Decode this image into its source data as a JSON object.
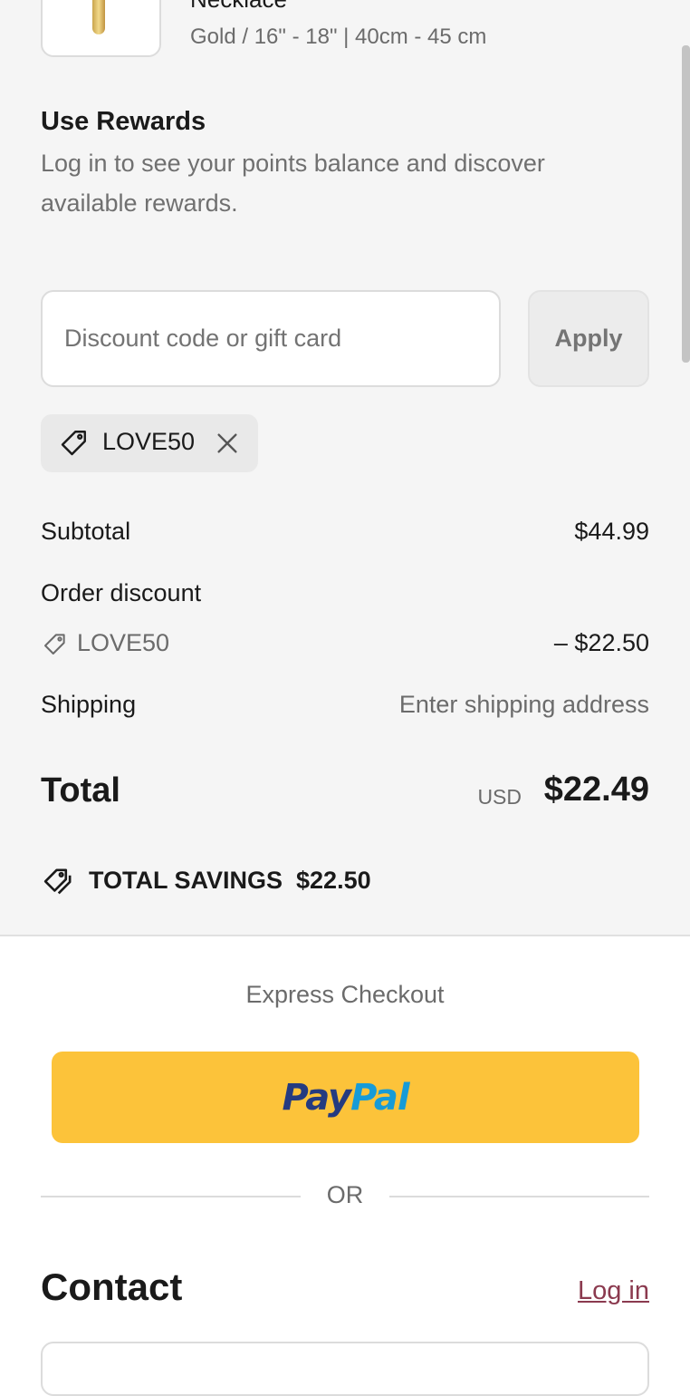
{
  "item": {
    "title": "Necklace",
    "variant": "Gold / 16\" - 18\" | 40cm - 45 cm"
  },
  "rewards": {
    "title": "Use Rewards",
    "text": "Log in to see your points balance and discover available rewards."
  },
  "discount": {
    "placeholder": "Discount code or gift card",
    "apply_label": "Apply",
    "applied_code": "LOVE50"
  },
  "summary": {
    "subtotal_label": "Subtotal",
    "subtotal_value": "$44.99",
    "order_discount_label": "Order discount",
    "discount_code": "LOVE50",
    "discount_value": "– $22.50",
    "shipping_label": "Shipping",
    "shipping_value": "Enter shipping address",
    "total_label": "Total",
    "currency": "USD",
    "total_value": "$22.49",
    "savings_label": "TOTAL SAVINGS  $22.50"
  },
  "express": {
    "title": "Express Checkout",
    "paypal_pay": "Pay",
    "paypal_pal": "Pal",
    "or_label": "OR"
  },
  "contact": {
    "title": "Contact",
    "login_label": "Log in"
  },
  "colors": {
    "summary_bg": "#f5f5f5",
    "paypal_yellow": "#fcc33a",
    "paypal_dark_blue": "#253b80",
    "paypal_light_blue": "#179bd7",
    "link": "#8b3a4f"
  }
}
